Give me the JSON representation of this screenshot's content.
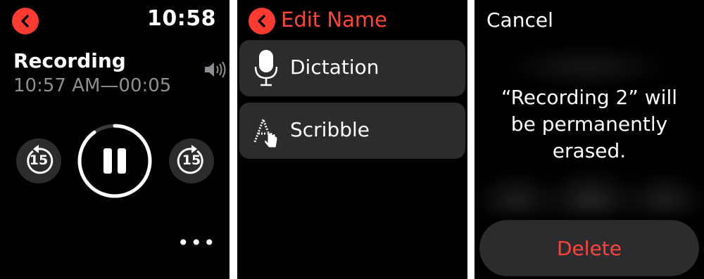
{
  "now_playing": {
    "time": "10:58",
    "title": "Recording",
    "subtitle": "10:57 AM—00:05",
    "skip_back_seconds": "15",
    "skip_forward_seconds": "15",
    "more_label": "•••",
    "playback_progress": 0.9
  },
  "edit_name": {
    "title": "Edit Name",
    "options": [
      {
        "label": "Dictation",
        "icon": "microphone-icon"
      },
      {
        "label": "Scribble",
        "icon": "scribble-icon"
      }
    ]
  },
  "delete_confirm": {
    "cancel_label": "Cancel",
    "message_lines": [
      "“Recording 2” will",
      "be permanently",
      "erased."
    ],
    "delete_label": "Delete"
  },
  "colors": {
    "accent_red": "#ff3b30",
    "text_red": "#ff453a",
    "card_gray": "#2c2c2e",
    "muted_text": "#8e8e93"
  }
}
